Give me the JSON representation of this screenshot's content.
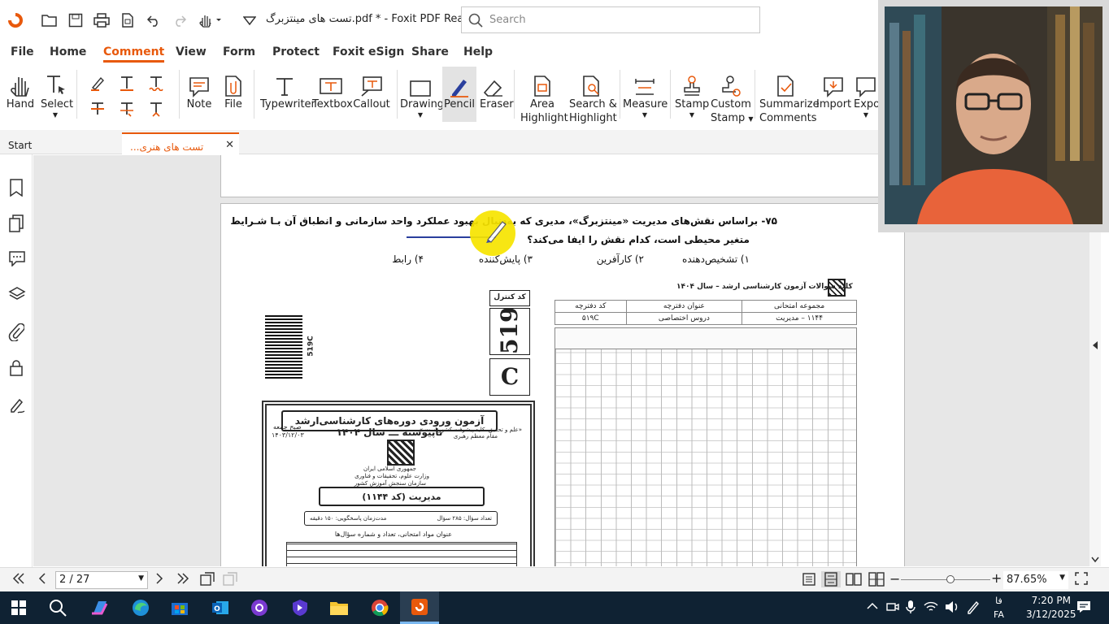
{
  "titlebar": {
    "title": "تست های مینتزبرگ.pdf * - Foxit PDF Rea...",
    "search_placeholder": "Search"
  },
  "menu": [
    "File",
    "Home",
    "Comment",
    "View",
    "Form",
    "Protect",
    "Foxit eSign",
    "Share",
    "Help"
  ],
  "menu_active": "Comment",
  "ribbon": {
    "hand": "Hand",
    "select": "Select",
    "note": "Note",
    "file": "File",
    "typewriter": "Typewriter",
    "textbox": "Textbox",
    "callout": "Callout",
    "drawing": "Drawing",
    "pencil": "Pencil",
    "eraser": "Eraser",
    "area_highlight": [
      "Area",
      "Highlight"
    ],
    "search_highlight": [
      "Search &",
      "Highlight"
    ],
    "measure": "Measure",
    "stamp": "Stamp",
    "custom_stamp": [
      "Custom",
      "Stamp"
    ],
    "summarize": [
      "Summarize",
      "Comments"
    ],
    "import": "Import",
    "export": "Expo"
  },
  "tabs": {
    "start": "Start",
    "doc": "...تست های هنری مینتزبر"
  },
  "page": {
    "question_line1": "۷۵-  براساس نقش‌های مدیریت «مینتزبرگ»، مدیری که به‌دنبال بهبود عملکرد واحد سازمانی و انطباق آن بـا شـرایط",
    "question_line2": "متغیر محیطی است، کدام نقش را ایفا می‌کند؟",
    "options": [
      "۱) تشخیص‌دهنده",
      "۲) کارآفرین",
      "۳) پایش‌کننده",
      "۴) رابط"
    ],
    "control_label": "کد کنترل",
    "control_number": "519",
    "control_letter": "C",
    "barcode_label": "519C",
    "cover_title": "آزمون ورودی دوره‌های کارشناسی‌ارشد ناپیوسته ـــ سال ۱۴۰۴",
    "cover_quote": "«علم و تحقیق، کلید پیشرفت کشور است.»",
    "cover_quote_by": "مقام معظم رهبری",
    "cover_gov": "جمهوری اسلامی ایران",
    "cover_ministry": "وزارت علوم، تحقیقات و فناوری",
    "cover_org": "سازمان سنجش آموزش کشور",
    "cover_day": "صبح جمعه",
    "cover_date": "۱۴۰۳/۱۲/۰۳",
    "cover_course": "مدیریت (کد ۱۱۴۴)",
    "cover_q_count": "تعداد سؤال: ۲۸۵ سؤال",
    "cover_duration": "مدت‌زمان پاسخگویی: ۱۵۰ دقیقه",
    "cover_table_title": "عنوان مواد امتحانی، تعداد و شماره سؤال‌ها",
    "key_title": "کلید سوالات آزمون کارشناسی ارشد – سال ۱۴۰۴",
    "key_headers": [
      "مجموعه امتحانی",
      "عنوان دفترچه",
      "کد دفترچه"
    ],
    "key_values": [
      "۱۱۴۴ – مدیریت",
      "دروس اختصاصی",
      "۵۱۹C"
    ]
  },
  "status": {
    "page_display": "2 / 27",
    "zoom": "87.65%",
    "zoom_slider_fraction": 0.55
  },
  "taskbar": {
    "time": "7:20 PM",
    "date": "3/12/2025",
    "lang_top": "فا",
    "lang_bottom": "FA"
  },
  "colors": {
    "accent": "#e8590c",
    "taskbar": "#0f2233",
    "pen_stroke": "#2a3f9d",
    "cursor_highlight": "#f7e400"
  }
}
